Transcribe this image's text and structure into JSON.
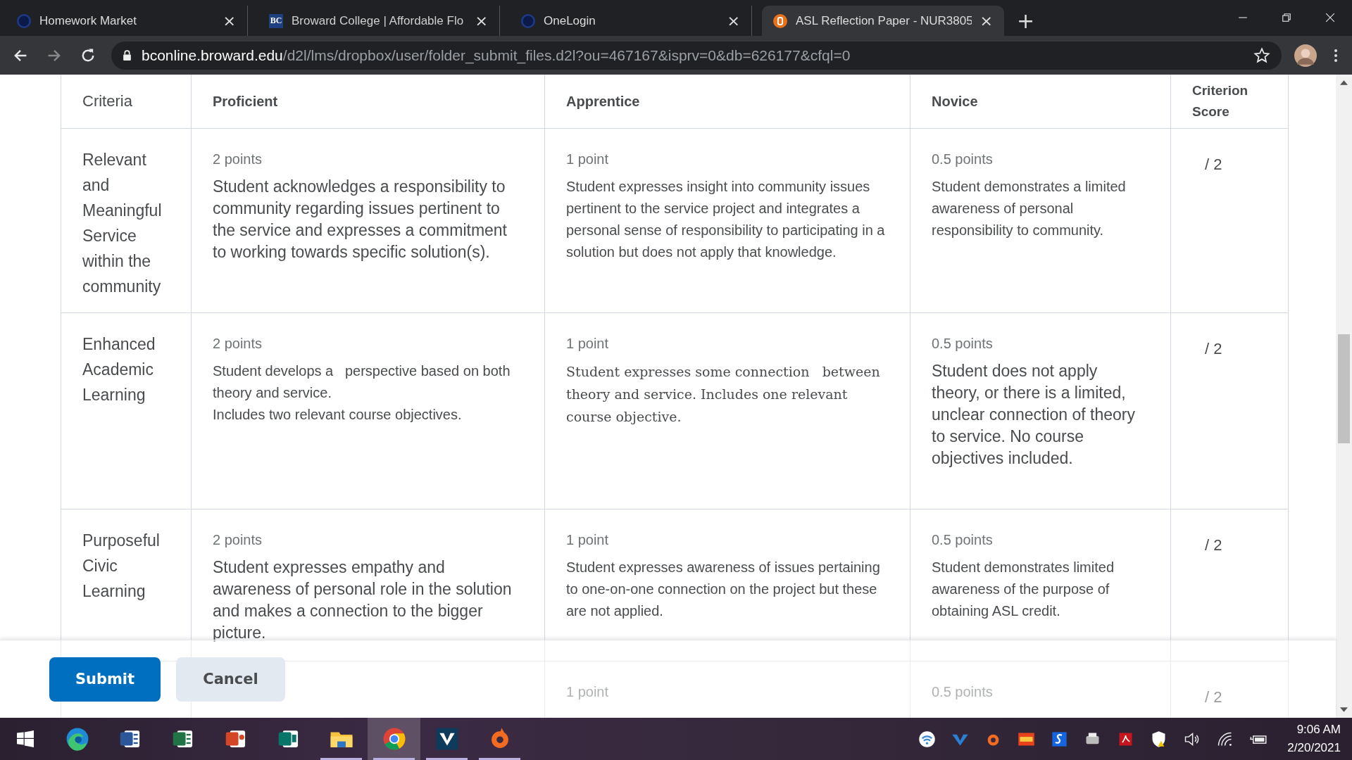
{
  "browser": {
    "tabs": [
      {
        "title": "Homework Market",
        "kind": "circle",
        "selected": false,
        "close": "×"
      },
      {
        "title": "Broward College | Affordable Flo",
        "kind": "bc",
        "selected": false,
        "close": "×"
      },
      {
        "title": "OneLogin",
        "kind": "circle",
        "selected": false,
        "close": "×"
      },
      {
        "title": "ASL Reflection Paper - NUR3805",
        "kind": "orange",
        "selected": true,
        "close": "×"
      }
    ],
    "new_tab": "+",
    "favicon_text": "BC",
    "address": {
      "host": "bconline.broward.edu",
      "path": "/d2l/lms/dropbox/user/folder_submit_files.d2l?ou=467167&isprv=0&db=626177&cfql=0"
    }
  },
  "rubric": {
    "columns": [
      "Criteria",
      "Proficient",
      "Apprentice",
      "Novice",
      "Criterion Score"
    ],
    "rows": [
      {
        "cells": [
          {
            "kind": "criterion",
            "text": "Relevant and Meaningful Service within the community"
          },
          {
            "points": "2 points",
            "kind": "large",
            "text": "Student acknowledges a responsibility to community regarding issues pertinent to the service and expresses a commitment to working towards specific solution(s)."
          },
          {
            "points": "1 point",
            "kind": "normal",
            "text": "Student expresses insight into community issues pertinent to the service project and integrates a personal sense of responsibility to participating in a solution but does not apply that knowledge."
          },
          {
            "points": "0.5 points",
            "kind": "normal",
            "text": "Student demonstrates a limited awareness of personal responsibility to community."
          },
          {
            "kind": "score",
            "text": "/ 2"
          }
        ]
      },
      {
        "cells": [
          {
            "kind": "criterion",
            "text": "Enhanced Academic Learning"
          },
          {
            "points": "2 points",
            "kind": "normal",
            "text": "Student develops a   perspective based on both theory and service.\nIncludes two relevant course objectives."
          },
          {
            "points": "1 point",
            "kind": "serif",
            "text": "Student expresses some connection   between theory and service. Includes one relevant course objective."
          },
          {
            "points": "0.5 points",
            "kind": "large",
            "text": "Student does not apply theory, or there is a limited, unclear connection of theory to service. No course objectives included."
          },
          {
            "kind": "score",
            "text": "/ 2"
          }
        ]
      },
      {
        "cells": [
          {
            "kind": "criterion",
            "text": "Purposeful Civic Learning"
          },
          {
            "points": "2 points",
            "kind": "large",
            "text": "Student expresses empathy and awareness of personal role in the solution and makes a connection to the bigger picture."
          },
          {
            "points": "1 point",
            "kind": "normal",
            "text": "Student expresses awareness of issues pertaining to one-on-one connection on the project but these are not applied."
          },
          {
            "points": "0.5 points",
            "kind": "normal",
            "text": "Student demonstrates limited awareness of the purpose of obtaining ASL credit."
          },
          {
            "kind": "score",
            "text": "/ 2"
          }
        ]
      },
      {
        "cells": [
          {
            "kind": "criterion",
            "text": ""
          },
          {
            "kind": "normal",
            "text": ""
          },
          {
            "kind": "normal",
            "points": "1 point"
          },
          {
            "kind": "normal",
            "points": "0.5 points"
          },
          {
            "kind": "score",
            "text": "/ 2"
          }
        ]
      }
    ]
  },
  "footer": {
    "buttons": [
      {
        "label": "Submit",
        "kind": "primary"
      },
      {
        "label": "Cancel",
        "kind": "secondary"
      }
    ]
  },
  "taskbar": {
    "apps": [
      {
        "kind": "edge",
        "selected": false,
        "running": false
      },
      {
        "kind": "word",
        "selected": false,
        "running": false
      },
      {
        "kind": "excel",
        "selected": false,
        "running": false
      },
      {
        "kind": "powerpoint",
        "selected": false,
        "running": false
      },
      {
        "kind": "publisher",
        "selected": false,
        "running": false
      },
      {
        "kind": "folder",
        "selected": false,
        "running": true
      },
      {
        "kind": "chrome",
        "selected": true,
        "running": true
      },
      {
        "kind": "vipre",
        "selected": false,
        "running": true
      },
      {
        "kind": "origin",
        "selected": false,
        "running": true
      }
    ],
    "time": "9:06 AM",
    "date": "2/20/2021"
  }
}
